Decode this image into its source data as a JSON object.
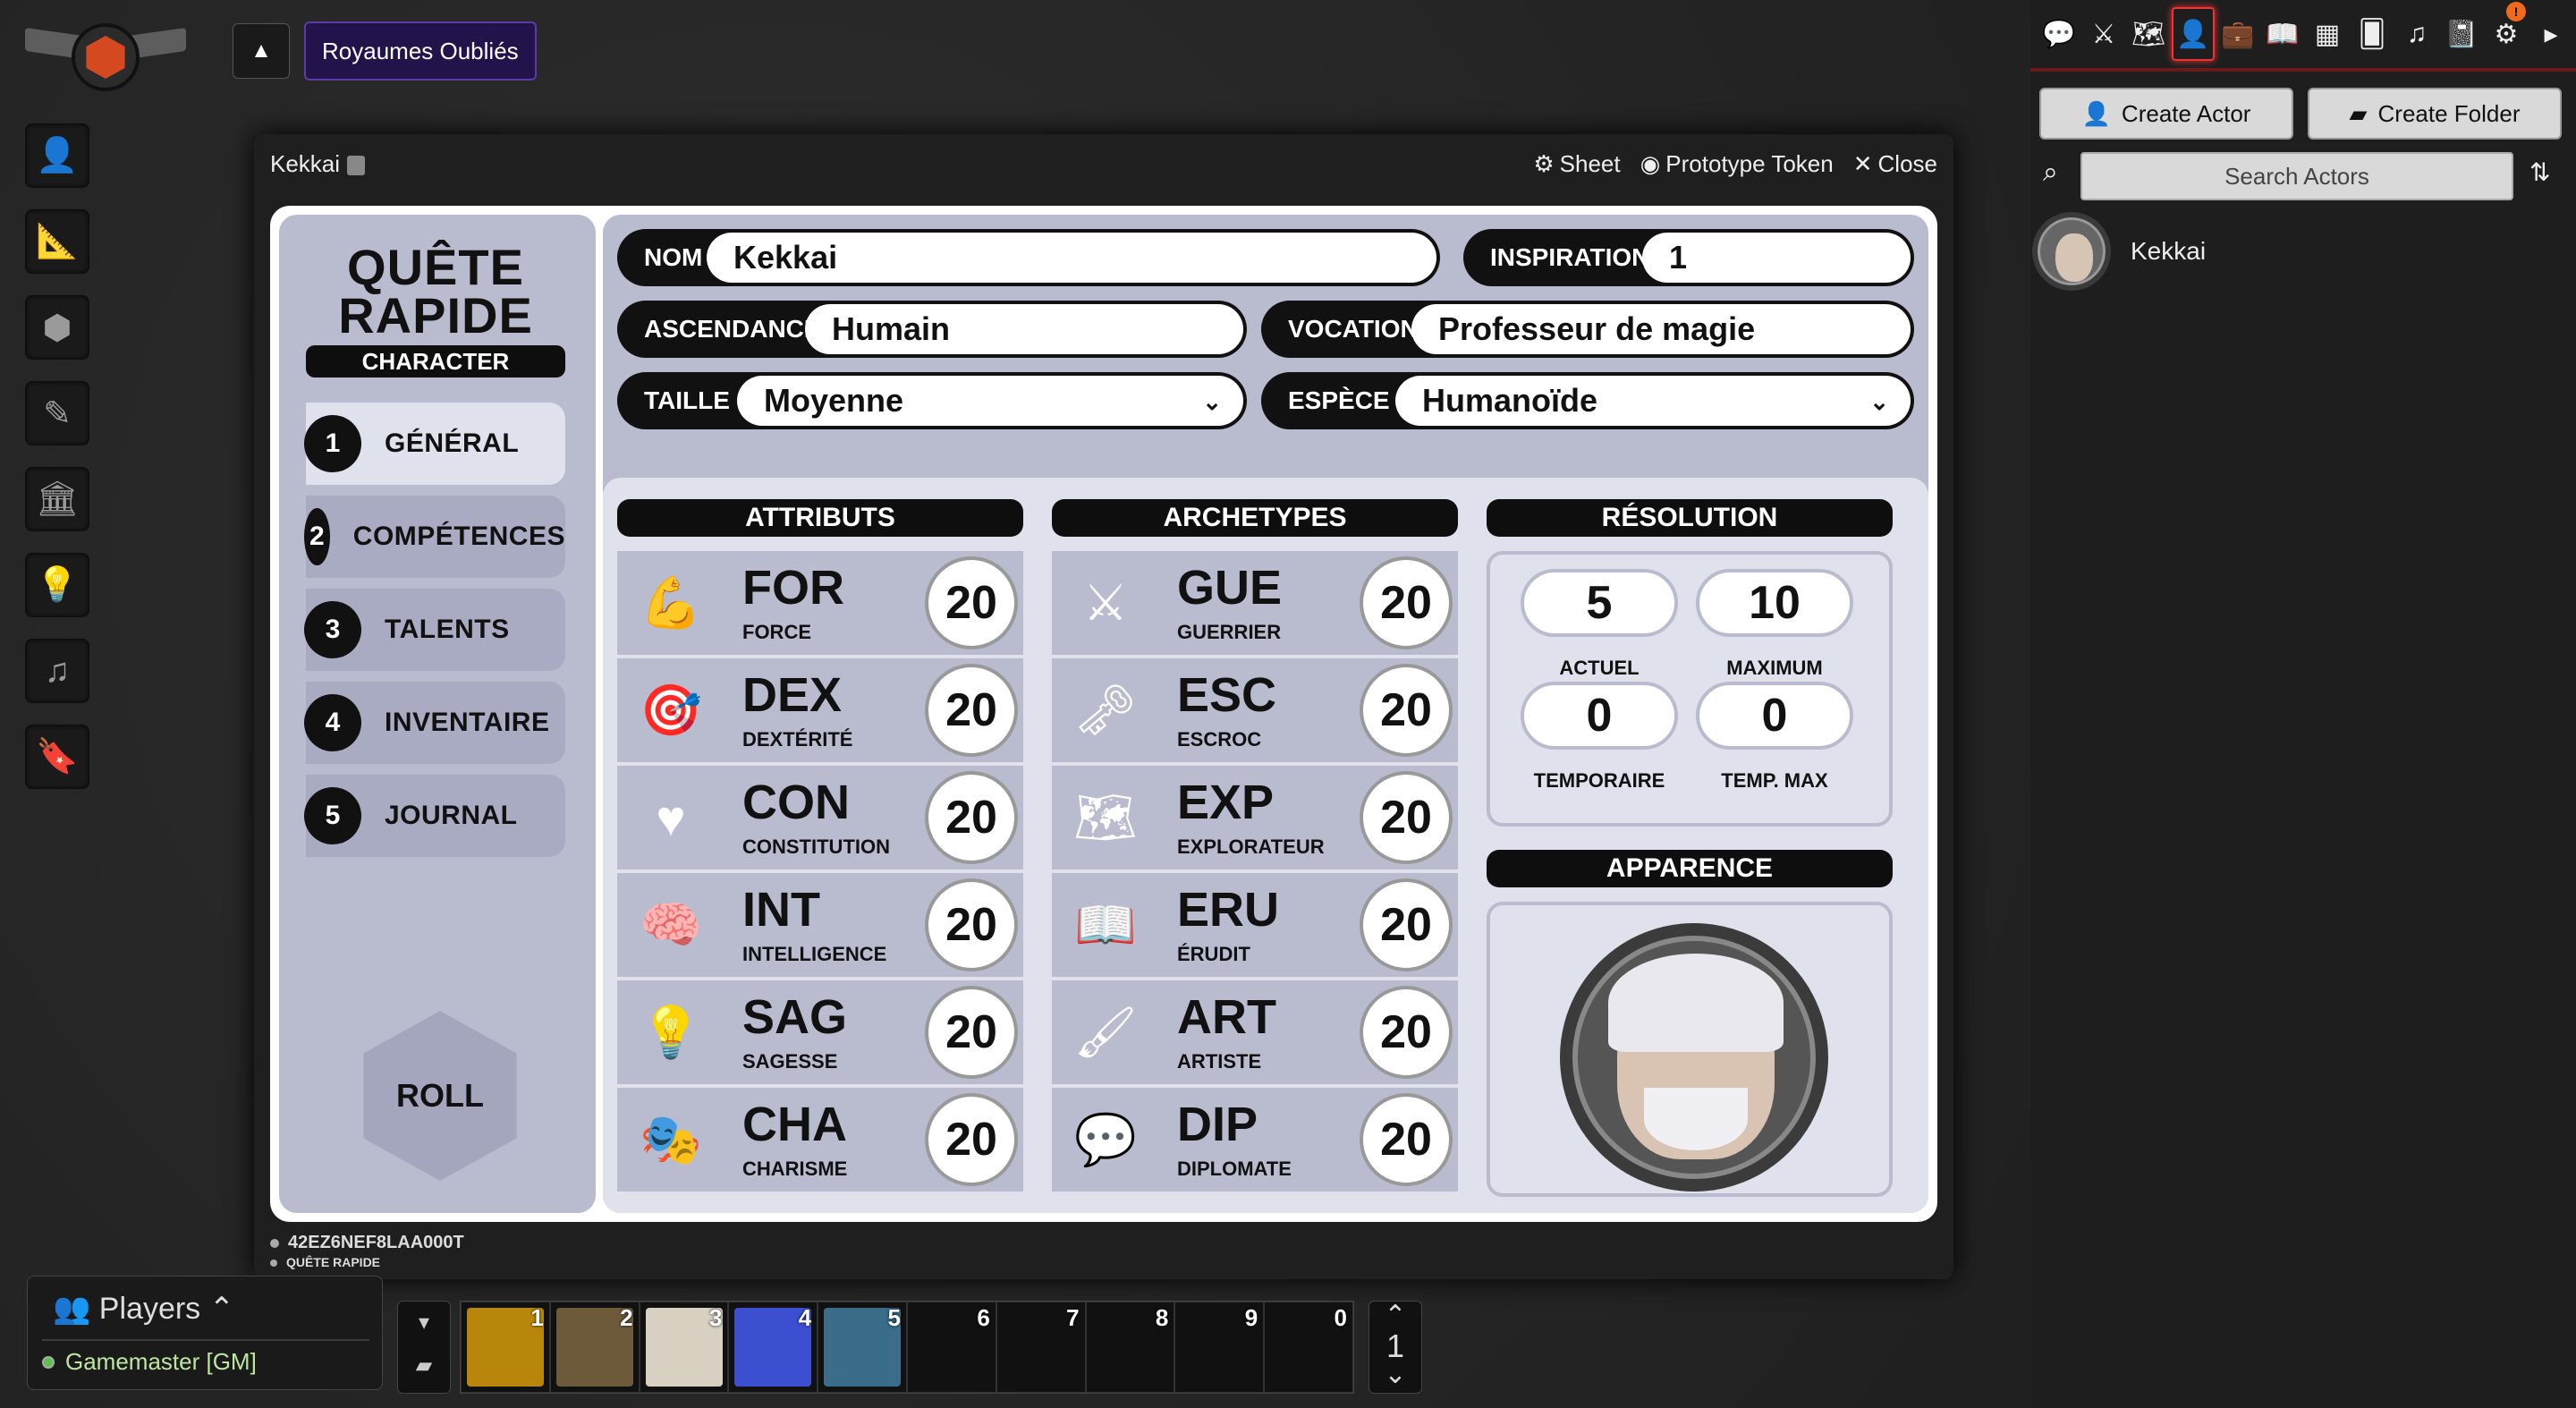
{
  "topbar": {
    "scene_name": "Royaumes Oubliés",
    "toggle_glyph": "▲"
  },
  "controls": [
    {
      "icon": "user-icon",
      "glyph": "👤"
    },
    {
      "icon": "ruler-icon",
      "glyph": "📐"
    },
    {
      "icon": "cubes-icon",
      "glyph": "⬢"
    },
    {
      "icon": "pencil-icon",
      "glyph": "✎"
    },
    {
      "icon": "landmark-icon",
      "glyph": "🏛"
    },
    {
      "icon": "lightbulb-icon",
      "glyph": "💡"
    },
    {
      "icon": "music-icon",
      "glyph": "♫"
    },
    {
      "icon": "bookmark-icon",
      "glyph": "🔖"
    }
  ],
  "sheet": {
    "title": "Kekkai",
    "actions": {
      "sheet": "Sheet",
      "prototype": "Prototype Token",
      "close": "Close"
    },
    "brand_line1": "QUÊTE",
    "brand_line2": "RAPIDE",
    "brand_sub": "CHARACTER",
    "nav": [
      {
        "num": "1",
        "label": "GÉNÉRAL"
      },
      {
        "num": "2",
        "label": "COMPÉTENCES"
      },
      {
        "num": "3",
        "label": "TALENTS"
      },
      {
        "num": "4",
        "label": "INVENTAIRE"
      },
      {
        "num": "5",
        "label": "JOURNAL"
      }
    ],
    "roll": "ROLL",
    "fields": {
      "nom_label": "NOM",
      "nom_value": "Kekkai",
      "inspiration_label": "INSPIRATION",
      "inspiration_value": "1",
      "ascendance_label": "ASCENDANCE",
      "ascendance_value": "Humain",
      "vocation_label": "VOCATION",
      "vocation_value": "Professeur de magie",
      "taille_label": "TAILLE",
      "taille_value": "Moyenne",
      "espece_label": "ESPÈCE",
      "espece_value": "Humanoïde"
    },
    "headers": {
      "attributs": "ATTRIBUTS",
      "archetypes": "ARCHETYPES",
      "resolution": "RÉSOLUTION",
      "apparence": "APPARENCE"
    },
    "attributs": [
      {
        "abbr": "FOR",
        "full": "FORCE",
        "value": "20",
        "icon": "strength-icon",
        "glyph": "💪"
      },
      {
        "abbr": "DEX",
        "full": "DEXTÉRITÉ",
        "value": "20",
        "icon": "target-icon",
        "glyph": "🎯"
      },
      {
        "abbr": "CON",
        "full": "CONSTITUTION",
        "value": "20",
        "icon": "heart-icon",
        "glyph": "♥"
      },
      {
        "abbr": "INT",
        "full": "INTELLIGENCE",
        "value": "20",
        "icon": "brain-icon",
        "glyph": "🧠"
      },
      {
        "abbr": "SAG",
        "full": "SAGESSE",
        "value": "20",
        "icon": "lightbulb-icon",
        "glyph": "💡"
      },
      {
        "abbr": "CHA",
        "full": "CHARISME",
        "value": "20",
        "icon": "masks-icon",
        "glyph": "🎭"
      }
    ],
    "archetypes": [
      {
        "abbr": "GUE",
        "full": "GUERRIER",
        "value": "20",
        "icon": "axe-icon",
        "glyph": "⚔"
      },
      {
        "abbr": "ESC",
        "full": "ESCROC",
        "value": "20",
        "icon": "lockpicks-icon",
        "glyph": "🗝"
      },
      {
        "abbr": "EXP",
        "full": "EXPLORATEUR",
        "value": "20",
        "icon": "map-icon",
        "glyph": "🗺"
      },
      {
        "abbr": "ERU",
        "full": "ÉRUDIT",
        "value": "20",
        "icon": "book-icon",
        "glyph": "📖"
      },
      {
        "abbr": "ART",
        "full": "ARTISTE",
        "value": "20",
        "icon": "brush-icon",
        "glyph": "🖌"
      },
      {
        "abbr": "DIP",
        "full": "DIPLOMATE",
        "value": "20",
        "icon": "speech-icon",
        "glyph": "💬"
      }
    ],
    "resolution": {
      "actuel_value": "5",
      "actuel_label": "ACTUEL",
      "maximum_value": "10",
      "maximum_label": "MAXIMUM",
      "temporaire_value": "0",
      "temporaire_label": "TEMPORAIRE",
      "tempmax_value": "0",
      "tempmax_label": "TEMP. MAX"
    },
    "footer_id": "42EZ6NEF8LAA000T",
    "footer_system": "QUÊTE RAPIDE"
  },
  "players": {
    "title": "Players",
    "gm": "Gamemaster [GM]"
  },
  "hotbar": {
    "slots": [
      {
        "n": "1",
        "color": "#b8860b"
      },
      {
        "n": "2",
        "color": "#6d5a3a"
      },
      {
        "n": "3",
        "color": "#d8d0c0"
      },
      {
        "n": "4",
        "color": "#3b4fd0"
      },
      {
        "n": "5",
        "color": "#3a6d8a"
      },
      {
        "n": "6",
        "color": ""
      },
      {
        "n": "7",
        "color": ""
      },
      {
        "n": "8",
        "color": ""
      },
      {
        "n": "9",
        "color": ""
      },
      {
        "n": "0",
        "color": ""
      }
    ],
    "page": "1"
  },
  "right_sidebar": {
    "tabs": [
      {
        "icon": "chat-icon",
        "glyph": "💬"
      },
      {
        "icon": "combat-icon",
        "glyph": "⚔"
      },
      {
        "icon": "scenes-icon",
        "glyph": "🗺"
      },
      {
        "icon": "actors-icon",
        "glyph": "👤",
        "active": true
      },
      {
        "icon": "items-icon",
        "glyph": "💼"
      },
      {
        "icon": "journal-icon",
        "glyph": "📖"
      },
      {
        "icon": "tables-icon",
        "glyph": "▦"
      },
      {
        "icon": "cards-icon",
        "glyph": "🂠"
      },
      {
        "icon": "playlists-icon",
        "glyph": "♫"
      },
      {
        "icon": "compendium-icon",
        "glyph": "📓"
      },
      {
        "icon": "settings-icon",
        "glyph": "⚙",
        "badge": "!"
      },
      {
        "icon": "collapse-icon",
        "glyph": "▸"
      }
    ],
    "create_actor": "Create Actor",
    "create_folder": "Create Folder",
    "search_placeholder": "Search Actors",
    "actors": [
      {
        "name": "Kekkai"
      }
    ]
  },
  "colors": {
    "panel": "#b9bccf",
    "panel_light": "#dfe1ec",
    "scene_bg": "#22134a",
    "active_tab": "#e33333"
  }
}
